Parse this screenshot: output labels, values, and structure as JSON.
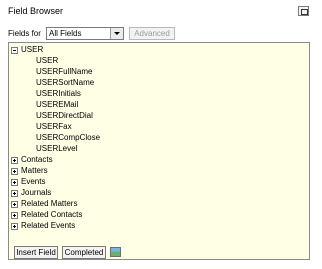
{
  "panel": {
    "title": "Field Browser"
  },
  "filter": {
    "label": "Fields for",
    "selected": "All Fields",
    "advanced_label": "Advanced"
  },
  "tree": {
    "user": {
      "label": "USER",
      "children": [
        "USER",
        "USERFullName",
        "USERSortName",
        "USERInitials",
        "USEREMail",
        "USERDirectDial",
        "USERFax",
        "USERCompClose",
        "USERLevel"
      ]
    },
    "groups": [
      "Contacts",
      "Matters",
      "Events",
      "Journals",
      "Related Matters",
      "Related Contacts",
      "Related Events"
    ]
  },
  "actions": {
    "insert_label": "Insert Field",
    "completed_label": "Completed",
    "image_icon": "image-icon"
  },
  "colors": {
    "tree_bg": "#ffffe6"
  }
}
